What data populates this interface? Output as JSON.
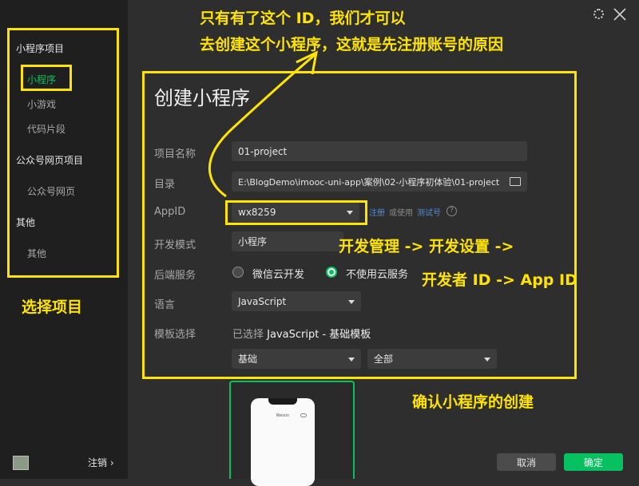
{
  "window": {
    "settings_icon": "gear-icon",
    "close_icon": "close-icon"
  },
  "sidebar": {
    "groups": [
      {
        "title": "小程序项目",
        "items": [
          "小程序",
          "小游戏",
          "代码片段"
        ]
      },
      {
        "title": "公众号网页项目",
        "items": [
          "公众号网页"
        ]
      },
      {
        "title": "其他",
        "items": [
          "其他"
        ]
      }
    ],
    "selected": "小程序",
    "logout_label": "注销",
    "logout_chevron": "›"
  },
  "form": {
    "title": "创建小程序",
    "project_name": {
      "label": "项目名称",
      "value": "01-project"
    },
    "directory": {
      "label": "目录",
      "value": "E:\\BlogDemo\\imooc-uni-app\\案例\\02-小程序初体验\\01-project"
    },
    "appid": {
      "label": "AppID",
      "value": "wx8259",
      "register_link": "注册",
      "or_use": "或使用",
      "test_link": "测试号",
      "help": "?"
    },
    "dev_mode": {
      "label": "开发模式",
      "value": "小程序"
    },
    "backend": {
      "label": "后端服务",
      "option1": "微信云开发",
      "option2": "不使用云服务",
      "selected": "不使用云服务"
    },
    "language": {
      "label": "语言",
      "value": "JavaScript"
    },
    "template": {
      "label": "模板选择",
      "selected_prefix": "已选择",
      "selected_value": "JavaScript - 基础模板",
      "category": "基础",
      "filter": "全部"
    }
  },
  "footer": {
    "cancel_label": "取消",
    "confirm_label": "确定"
  },
  "annotations": {
    "top_line1": "只有有了这个 ID，我们才可以",
    "top_line2": "去创建这个小程序，这就是先注册账号的原因",
    "right_line1": "开发管理 -> 开发设置 ->",
    "right_line2": "开发者 ID -> App ID",
    "left_note": "选择项目",
    "bottom_note": "确认小程序的创建"
  },
  "preview": {
    "header_text": "Weixin"
  },
  "colors": {
    "accent": "#07c160",
    "annotation": "#ffe400",
    "sidebar_bg": "#1f1f1f",
    "main_bg": "#2e2e2e"
  }
}
